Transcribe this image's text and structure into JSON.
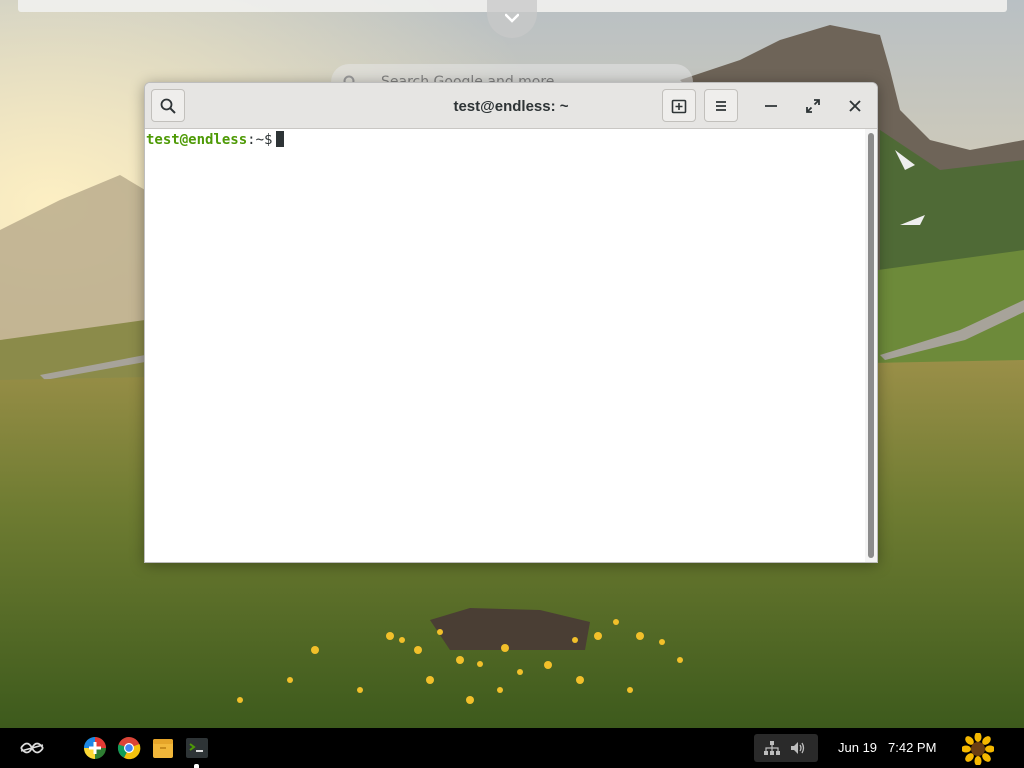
{
  "desktop": {
    "search_placeholder": "Search Google and more"
  },
  "terminal": {
    "title": "test@endless: ~",
    "prompt_user_host": "test@endless",
    "prompt_path": ":~$",
    "icons": {
      "search": "search-icon",
      "new_tab": "new-tab-icon",
      "menu": "hamburger-menu-icon",
      "minimize": "minimize-icon",
      "maximize": "maximize-icon",
      "close": "close-icon"
    }
  },
  "taskbar": {
    "apps": [
      {
        "name": "app-center-icon"
      },
      {
        "name": "chrome-icon"
      },
      {
        "name": "files-icon"
      },
      {
        "name": "terminal-icon",
        "running": true
      }
    ],
    "tray": {
      "network": "network-icon",
      "volume": "volume-icon"
    },
    "date": "Jun 19",
    "time": "7:42 PM",
    "user_menu": "sunflower-avatar-icon"
  },
  "colors": {
    "prompt_green": "#4e9a06",
    "headerbar": "#e6e5e3",
    "taskbar": "#000000"
  }
}
